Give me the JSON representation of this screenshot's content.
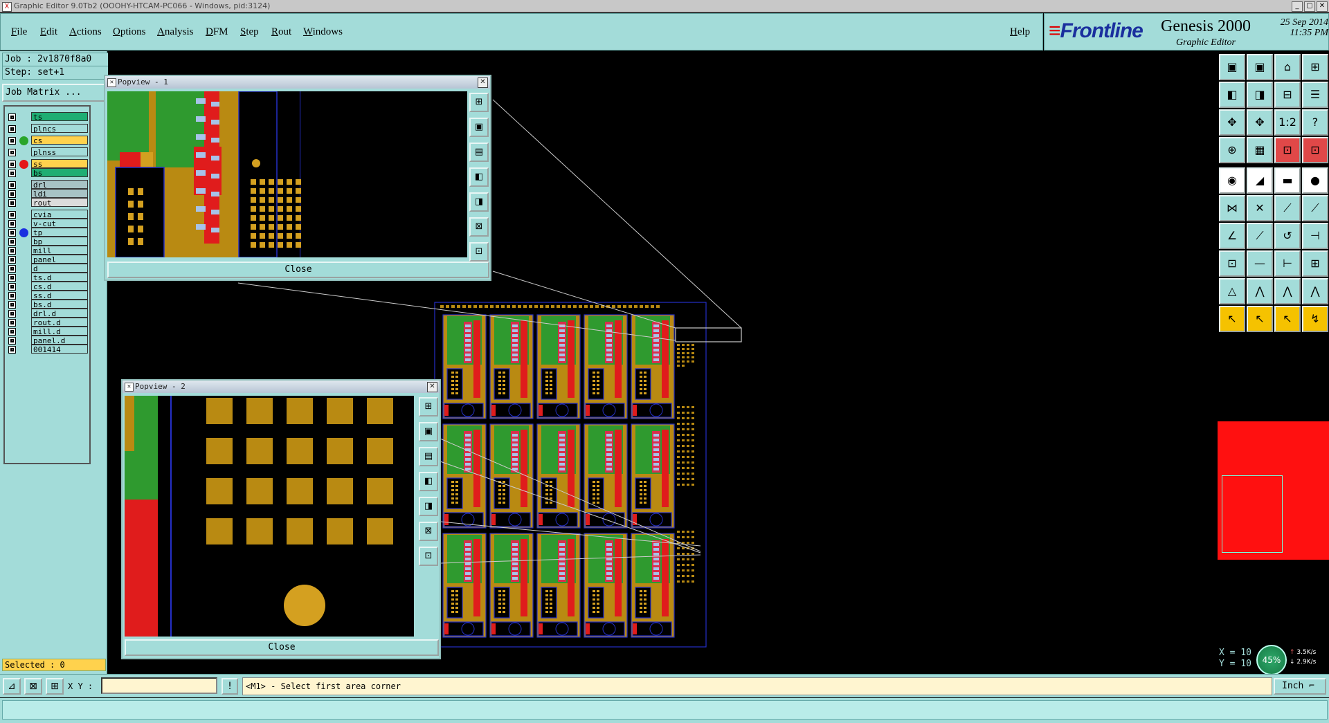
{
  "window": {
    "title": "Graphic Editor 9.0Tb2 (OOOHY-HTCAM-PC066 - Windows, pid:3124)",
    "icon": "X"
  },
  "window_controls": {
    "minimize": "_",
    "restore": "▢",
    "close": "✕"
  },
  "menu": [
    "File",
    "Edit",
    "Actions",
    "Options",
    "Analysis",
    "DFM",
    "Step",
    "Rout",
    "Windows"
  ],
  "help_label": "Help",
  "brand": {
    "logo": "Frontline",
    "product": "Genesis 2000",
    "subtitle": "Graphic Editor",
    "date": "25 Sep 2014",
    "time": "11:35 PM"
  },
  "job": {
    "job_text": "Job : 2v1870f8a0",
    "step_text": "Step: set+1",
    "matrix_label": "Job Matrix ..."
  },
  "layers": [
    {
      "name": "ts",
      "bg": "#1fae73",
      "dot": ""
    },
    {
      "name": "plncs",
      "bg": "#a3dcd9",
      "dot": ""
    },
    {
      "name": "cs",
      "bg": "#ffd24d",
      "dot": "#2aa52a"
    },
    {
      "name": "plnss",
      "bg": "#a3dcd9",
      "dot": ""
    },
    {
      "name": "ss",
      "bg": "#ffd24d",
      "dot": "#e41818"
    },
    {
      "name": "bs",
      "bg": "#1fae73",
      "dot": ""
    },
    {
      "name": "drl",
      "bg": "#a7c3c5",
      "dot": ""
    },
    {
      "name": "ldi",
      "bg": "#a7c3c5",
      "dot": ""
    },
    {
      "name": "rout",
      "bg": "#dcdcdc",
      "dot": ""
    },
    {
      "name": "cvia",
      "bg": "#a3dcd9",
      "dot": ""
    },
    {
      "name": "v-cut",
      "bg": "#a3dcd9",
      "dot": ""
    },
    {
      "name": "tp",
      "bg": "#a3dcd9",
      "dot": "#1b2fe0"
    },
    {
      "name": "bp",
      "bg": "#a3dcd9",
      "dot": ""
    },
    {
      "name": "mill",
      "bg": "#a3dcd9",
      "dot": ""
    },
    {
      "name": "panel",
      "bg": "#a3dcd9",
      "dot": ""
    },
    {
      "name": "d",
      "bg": "#a3dcd9",
      "dot": ""
    },
    {
      "name": "ts.d",
      "bg": "#a3dcd9",
      "dot": ""
    },
    {
      "name": "cs.d",
      "bg": "#a3dcd9",
      "dot": ""
    },
    {
      "name": "ss.d",
      "bg": "#a3dcd9",
      "dot": ""
    },
    {
      "name": "bs.d",
      "bg": "#a3dcd9",
      "dot": ""
    },
    {
      "name": "drl.d",
      "bg": "#a3dcd9",
      "dot": ""
    },
    {
      "name": "rout.d",
      "bg": "#a3dcd9",
      "dot": ""
    },
    {
      "name": "mill.d",
      "bg": "#a3dcd9",
      "dot": ""
    },
    {
      "name": "panel.d",
      "bg": "#a3dcd9",
      "dot": ""
    },
    {
      "name": "001414",
      "bg": "#a3dcd9",
      "dot": ""
    }
  ],
  "selected_text": "Selected : 0",
  "popview1": {
    "title": "Popview - 1",
    "close_label": "Close"
  },
  "popview2": {
    "title": "Popview - 2",
    "close_label": "Close"
  },
  "popup_tools": [
    "⊞",
    "▣",
    "▤",
    "◧",
    "◨",
    "⊠",
    "⊡"
  ],
  "status": {
    "xy_label": "X Y :",
    "xy_value": "",
    "info_icon": "!",
    "prompt": "<M1> - Select first area corner",
    "units": "Inch",
    "units_arrow": "⌐"
  },
  "status_buttons": [
    "⊿",
    "⊠",
    "⊞"
  ],
  "coords": {
    "x": "X  =  10",
    "y": "Y  =  10"
  },
  "network": {
    "percent": "45%",
    "up": "3.5K/s",
    "down": "2.9K/s"
  },
  "tools": [
    "▣",
    "▣",
    "⌂",
    "⊞",
    "◧",
    "◨",
    "⊟",
    "☰",
    "✥",
    "✥",
    "1:2",
    "?",
    "⊕",
    "▦",
    "⊡",
    "⊡",
    "◉",
    "◢",
    "▬",
    "●",
    "⋈",
    "✕",
    "⟋",
    "⟋",
    "∠",
    "⟋",
    "↺",
    "⊣",
    "⊡",
    "—",
    "⊢",
    "⊞",
    "△",
    "⋀",
    "⋀",
    "⋀",
    "↖",
    "↖",
    "↖",
    "↯"
  ]
}
